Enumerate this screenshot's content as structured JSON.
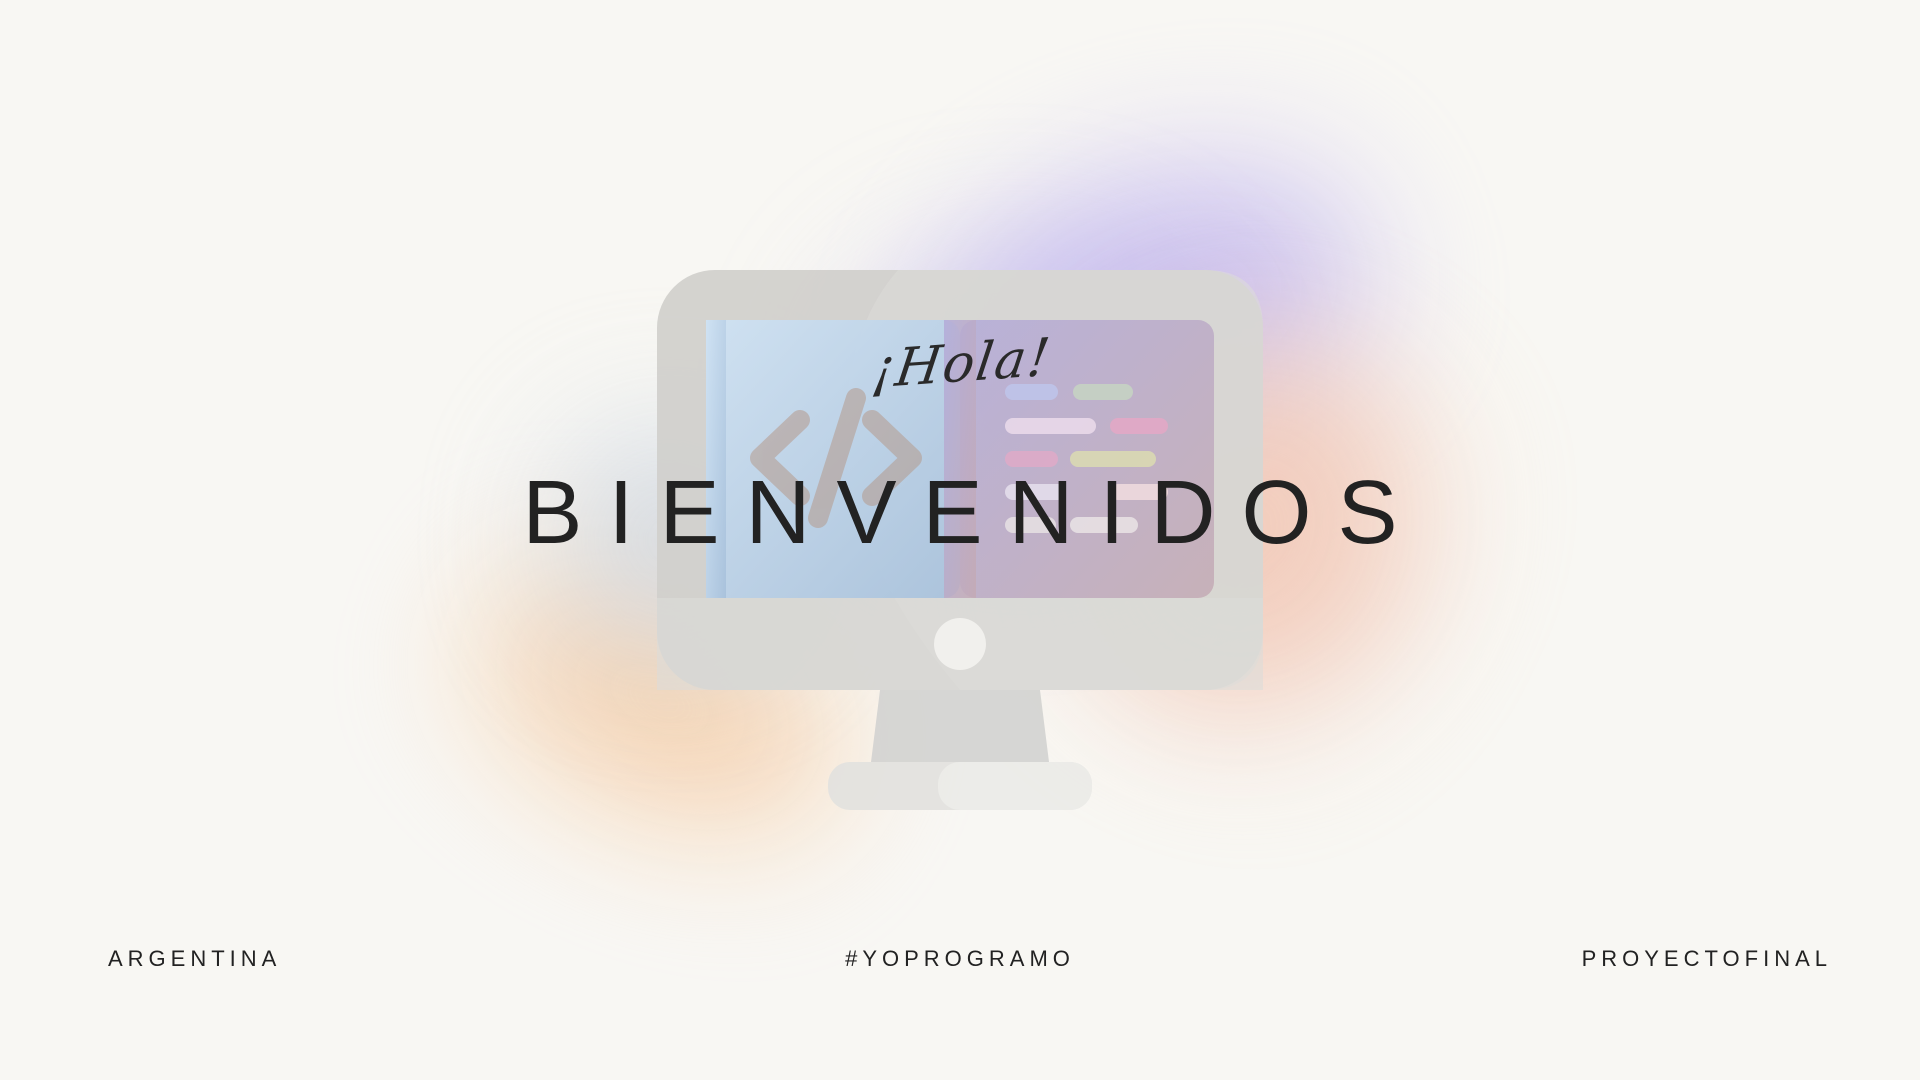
{
  "greeting": "¡Hola!",
  "title": "BIENVENIDOS",
  "footer": {
    "left": "ARGENTINA",
    "center": "#YOPROGRAMO",
    "right": "PROYECTOFINAL"
  },
  "icons": {
    "illustration": "desktop-computer-code-icon",
    "code_symbol": "code-brackets-icon"
  },
  "colors": {
    "background": "#f8f7f3",
    "text": "#222222",
    "blob_purple": "#c7bdf0",
    "blob_peach": "#f2c9b8",
    "blob_orange": "#f6d2b0"
  }
}
